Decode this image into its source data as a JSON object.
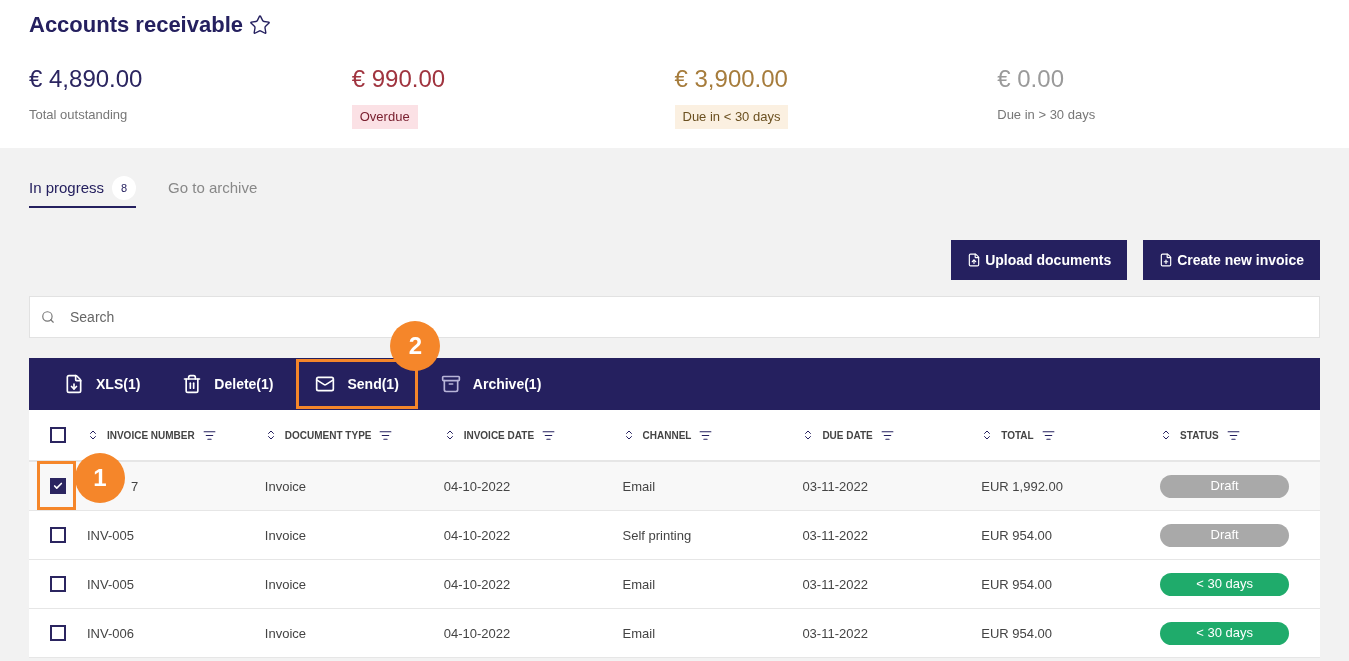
{
  "title": "Accounts receivable",
  "favorite": false,
  "summary": [
    {
      "amount": "€ 4,890.00",
      "label": "Total outstanding",
      "kind": "plain"
    },
    {
      "amount": "€ 990.00",
      "label": "Overdue",
      "kind": "overdue"
    },
    {
      "amount": "€ 3,900.00",
      "label": "Due in < 30 days",
      "kind": "soon"
    },
    {
      "amount": "€ 0.00",
      "label": "Due in > 30 days",
      "kind": "later"
    }
  ],
  "tabs": [
    {
      "label": "In progress",
      "count": "8",
      "selected": true
    },
    {
      "label": "Go to archive",
      "selected": false
    }
  ],
  "buttons": [
    "Upload documents",
    "Create new invoice"
  ],
  "search": {
    "placeholder": "Search"
  },
  "actions": [
    {
      "label": "XLS(1)",
      "kind": "xls",
      "highlighted": false
    },
    {
      "label": "Delete(1)",
      "kind": "delete",
      "highlighted": false
    },
    {
      "label": "Send(1)",
      "kind": "send",
      "highlighted": true,
      "callout": "2"
    },
    {
      "label": "Archive(1)",
      "kind": "archive",
      "highlighted": false
    }
  ],
  "table": {
    "all_checked": false,
    "columns": [
      "INVOICE NUMBER",
      "DOCUMENT TYPE",
      "INVOICE DATE",
      "CHANNEL",
      "DUE DATE",
      "TOTAL",
      "STATUS"
    ],
    "rows": [
      {
        "checked": true,
        "callout": "1",
        "cells": [
          "7",
          "Invoice",
          "04-10-2022",
          "Email",
          "03-11-2022",
          "EUR 1,992.00"
        ],
        "status": {
          "label": "Draft",
          "kind": "draft"
        }
      },
      {
        "checked": false,
        "cells": [
          "INV-005",
          "Invoice",
          "04-10-2022",
          "Self printing",
          "03-11-2022",
          "EUR 954.00"
        ],
        "status": {
          "label": "Draft",
          "kind": "draft"
        }
      },
      {
        "checked": false,
        "cells": [
          "INV-005",
          "Invoice",
          "04-10-2022",
          "Email",
          "03-11-2022",
          "EUR 954.00"
        ],
        "status": {
          "label": "< 30 days",
          "kind": "due"
        }
      },
      {
        "checked": false,
        "cells": [
          "INV-006",
          "Invoice",
          "04-10-2022",
          "Email",
          "03-11-2022",
          "EUR 954.00"
        ],
        "status": {
          "label": "< 30 days",
          "kind": "due"
        }
      }
    ]
  }
}
